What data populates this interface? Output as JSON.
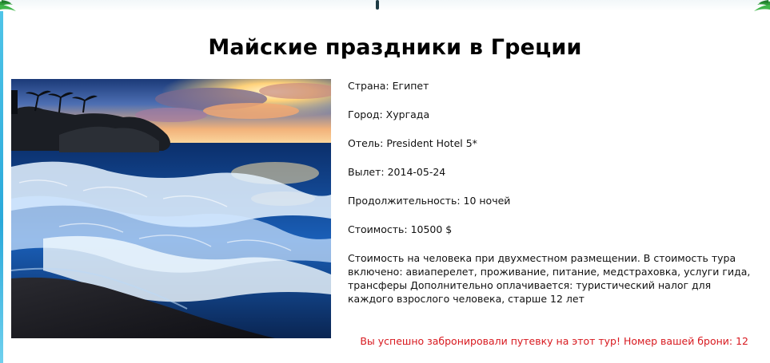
{
  "tour": {
    "title": "Майские праздники в Греции",
    "country": "Страна: Египет",
    "city": "Город: Хургада",
    "hotel": "Отель: President Hotel 5*",
    "departure": "Вылет: 2014-05-24",
    "duration": "Продолжительность: 10 ночей",
    "price": "Стоимость: 10500 $",
    "description": "Стоимость на человека при двухместном размещении. В стоимость тура включено: авиаперелет, проживание, питание, медстраховка, услуги гида, трансферы Дополнительно оплачивается: туристический налог для каждого взрослого человека, старше 12 лет"
  },
  "booking": {
    "success_message": "Вы успешно забронировали путевку на этот тур! Номер вашей брони: 12"
  },
  "colors": {
    "success_text": "#d8191f",
    "left_border": "#2aa9da"
  },
  "icons": {
    "top_left": "palm-leaf-icon",
    "top_right": "palm-leaf-icon"
  }
}
